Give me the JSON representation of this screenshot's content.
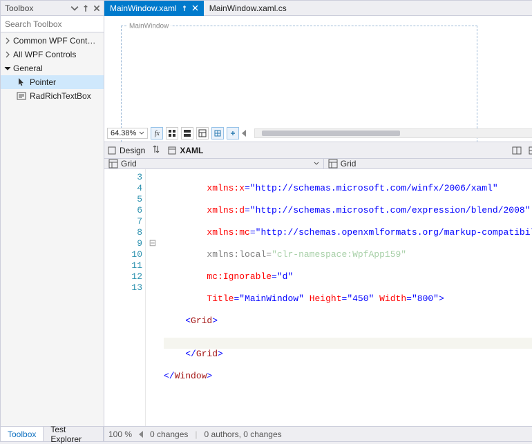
{
  "toolbox": {
    "title": "Toolbox",
    "search_placeholder": "Search Toolbox",
    "categories": {
      "common_wpf": "Common WPF Cont…",
      "all_wpf": "All WPF Controls",
      "general": "General"
    },
    "items": {
      "pointer": "Pointer",
      "radrichtextbox": "RadRichTextBox"
    },
    "bottom_tabs": {
      "toolbox": "Toolbox",
      "test_explorer": "Test Explorer"
    }
  },
  "doc_tabs": {
    "active": "MainWindow.xaml",
    "inactive": "MainWindow.xaml.cs"
  },
  "designer": {
    "window_title": "MainWindow",
    "zoom": "64.38%"
  },
  "split": {
    "design_label": "Design",
    "xaml_label": "XAML"
  },
  "grid_dropdowns": {
    "left": "Grid",
    "right": "Grid"
  },
  "code": {
    "line_numbers": [
      "3",
      "4",
      "5",
      "6",
      "7",
      "8",
      "9",
      "10",
      "11",
      "12",
      "13"
    ],
    "lines": {
      "l3_attr": "xmlns:x",
      "l3_val": "\"http://schemas.microsoft.com/winfx/2006/xaml\"",
      "l4_attr": "xmlns:d",
      "l4_val": "\"http://schemas.microsoft.com/expression/blend/2008\"",
      "l5_attr": "xmlns:mc",
      "l5_val": "\"http://schemas.openxmlformats.org/markup-compatibility/",
      "l6_attr": "xmlns:local",
      "l6_val": "\"clr-namespace:WpfApp159\"",
      "l7_attr": "mc:Ignorable",
      "l7_val": "\"d\"",
      "l8_a1": "Title",
      "l8_v1": "\"MainWindow\"",
      "l8_a2": "Height",
      "l8_v2": "\"450\"",
      "l8_a3": "Width",
      "l8_v3": "\"800\"",
      "l9_open": "<",
      "l9_name": "Grid",
      "l9_close": ">",
      "l11_open": "</",
      "l11_name": "Grid",
      "l11_close": ">",
      "l12_open": "</",
      "l12_name": "Window",
      "l12_close": ">"
    }
  },
  "statusbar": {
    "zoom": "100 %",
    "changes": "0 changes",
    "authors": "0 authors, 0 changes"
  }
}
